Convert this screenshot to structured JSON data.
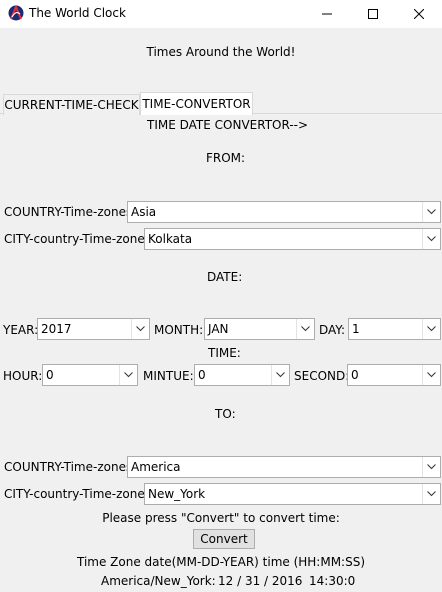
{
  "window": {
    "title": "The World Clock",
    "icon": "app-logo-icon",
    "controls": [
      "minimize-icon",
      "maximize-icon",
      "close-icon"
    ]
  },
  "header": {
    "text": "Times Around the World!"
  },
  "tabs": [
    {
      "label": "CURRENT-TIME-CHECK",
      "active": false
    },
    {
      "label": "TIME-CONVERTOR",
      "active": true
    }
  ],
  "convertor": {
    "heading": "TIME  DATE CONVERTOR-->",
    "from": {
      "section_label": "FROM:",
      "country_label": "COUNTRY-Time-zones",
      "country_value": "Asia",
      "city_label": "CITY-country-Time-zones",
      "city_value": "Kolkata"
    },
    "date": {
      "section_label": "DATE:",
      "year_label": "YEAR:",
      "year_value": "2017",
      "month_label": "MONTH:",
      "month_value": "JAN",
      "day_label": "DAY:",
      "day_value": "1"
    },
    "time": {
      "section_label": "TIME:",
      "hour_label": "HOUR:",
      "hour_value": "0",
      "minute_label": "MINTUE:",
      "minute_value": "0",
      "second_label": "SECOND:",
      "second_value": "0"
    },
    "to": {
      "section_label": "TO:",
      "country_label": "COUNTRY-Time-zones",
      "country_value": "America",
      "city_label": "CITY-country-Time-zones",
      "city_value": "New_York"
    },
    "instruction": "Please press \"Convert\" to convert time:",
    "convert_button": "Convert",
    "result_header": "Time Zone date(MM-DD-YEAR)  time (HH:MM:SS)",
    "result": {
      "zone": "America/New_York:",
      "date": "12 / 31 / 2016",
      "time": "14:30:0"
    }
  }
}
